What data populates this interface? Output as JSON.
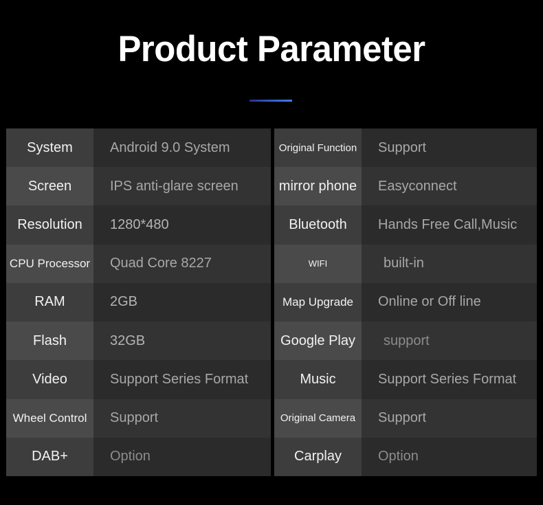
{
  "header": {
    "title": "Product Parameter",
    "accent_color": "#3d7fe8"
  },
  "theme": {
    "background": "#000000",
    "label_cell_odd": "#3d3d3d",
    "label_cell_even": "#4a4a4a",
    "value_cell_odd": "#2b2b2b",
    "value_cell_even": "#333333",
    "label_text": "#f2f2f2",
    "value_text": "#a8a8a8"
  },
  "tables": {
    "left": {
      "rows": [
        {
          "label": "System",
          "value": "Android 9.0 System"
        },
        {
          "label": "Screen",
          "value": "IPS anti-glare screen"
        },
        {
          "label": "Resolution",
          "value": "1280*480"
        },
        {
          "label": "CPU Processor",
          "value": "Quad Core 8227"
        },
        {
          "label": "RAM",
          "value": "2GB"
        },
        {
          "label": "Flash",
          "value": "32GB"
        },
        {
          "label": "Video",
          "value": "Support Series Format"
        },
        {
          "label": "Wheel Control",
          "value": "Support"
        },
        {
          "label": "DAB+",
          "value": "Option"
        }
      ]
    },
    "right": {
      "rows": [
        {
          "label": "Original Function",
          "value": "Support"
        },
        {
          "label": "mirror phone",
          "value": "Easyconnect"
        },
        {
          "label": "Bluetooth",
          "value": "Hands Free Call,Music"
        },
        {
          "label": "WIFI",
          "value": "built-in"
        },
        {
          "label": "Map Upgrade",
          "value": "Online or Off line"
        },
        {
          "label": "Google Play",
          "value": "support"
        },
        {
          "label": "Music",
          "value": "Support Series Format"
        },
        {
          "label": "Original Camera",
          "value": "Support"
        },
        {
          "label": "Carplay",
          "value": "Option"
        }
      ]
    }
  }
}
